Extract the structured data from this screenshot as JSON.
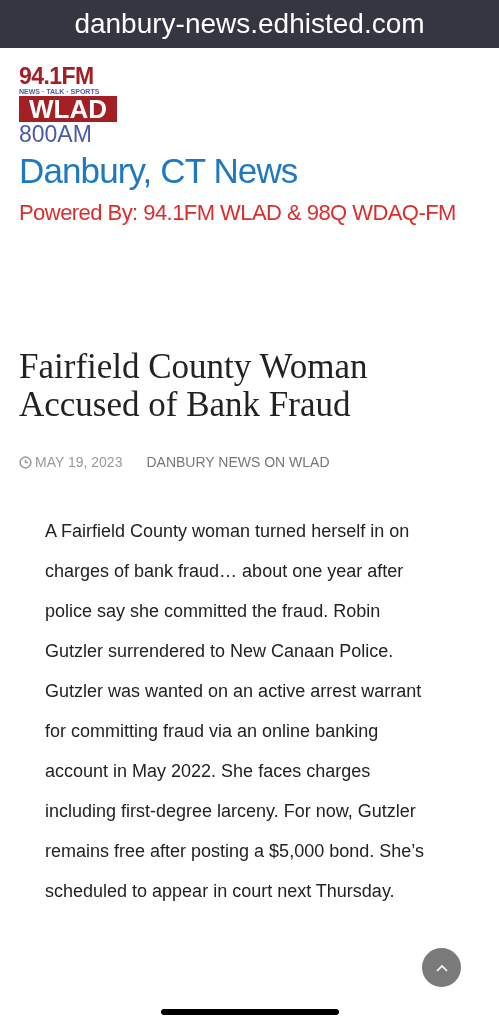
{
  "address_bar": {
    "url": "danbury-news.edhisted.com"
  },
  "logo": {
    "frequency": "94.1FM",
    "tagline": "NEWS · TALK · SPORTS",
    "call_sign": "WLAD",
    "am": "800AM"
  },
  "site": {
    "title": "Danbury, CT News",
    "subtitle": "Powered By: 94.1FM WLAD & 98Q WDAQ-FM"
  },
  "article": {
    "title": "Fairfield County Woman Accused of Bank Fraud",
    "date": "MAY 19, 2023",
    "author": "DANBURY NEWS ON WLAD",
    "body": "A Fairfield County woman turned herself in on charges of bank fraud… about one year after police say she committed the fraud. Robin Gutzler surrendered to New Canaan Police. Gutzler was wanted on an active arrest warrant for committing fraud via an online banking account in May 2022. She faces charges including first-degree larceny. For now, Gutzler remains free after posting a $5,000 bond. She’s scheduled to appear in court next Thursday."
  }
}
